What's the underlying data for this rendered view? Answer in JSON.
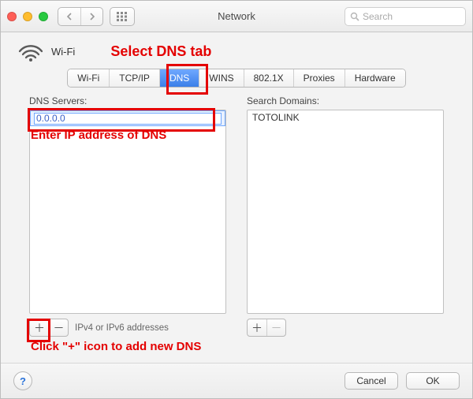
{
  "window": {
    "title": "Network"
  },
  "toolbar": {
    "search_placeholder": "Search"
  },
  "header": {
    "connection_name": "Wi-Fi"
  },
  "tabs": {
    "items": [
      {
        "label": "Wi-Fi"
      },
      {
        "label": "TCP/IP"
      },
      {
        "label": "DNS"
      },
      {
        "label": "WINS"
      },
      {
        "label": "802.1X"
      },
      {
        "label": "Proxies"
      },
      {
        "label": "Hardware"
      }
    ],
    "selected_index": 2
  },
  "dns": {
    "title": "DNS Servers:",
    "input_value": "0.0.0.0",
    "hint": "IPv4 or IPv6 addresses"
  },
  "search_domains": {
    "title": "Search Domains:",
    "items": [
      "TOTOLINK"
    ]
  },
  "buttons": {
    "cancel": "Cancel",
    "ok": "OK",
    "help": "?"
  },
  "annotations": {
    "select_dns": "Select DNS tab",
    "enter_ip": "Enter IP address of DNS",
    "click_plus": "Click \"+\" icon to add new DNS"
  },
  "glyphs": {
    "plus": "＋",
    "minus": "－"
  }
}
